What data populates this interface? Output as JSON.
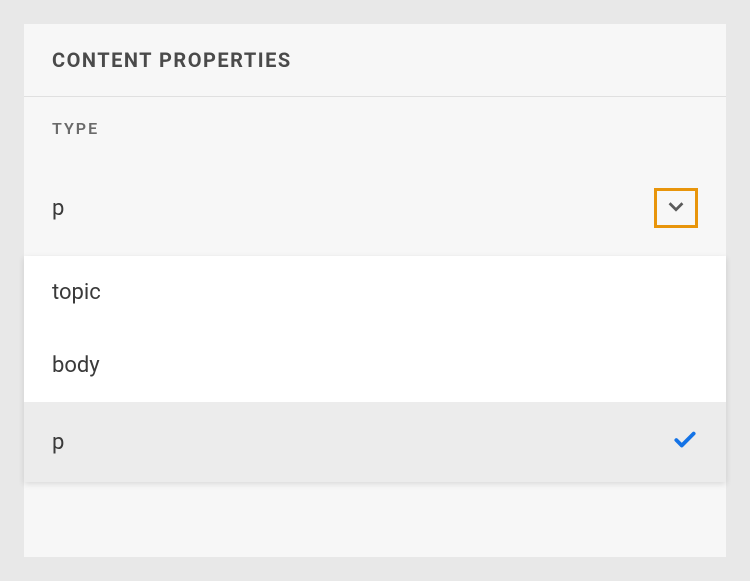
{
  "panel": {
    "title": "CONTENT PROPERTIES",
    "section_label": "TYPE",
    "selected_value": "p"
  },
  "dropdown": {
    "options": [
      {
        "label": "topic",
        "selected": false
      },
      {
        "label": "body",
        "selected": false
      },
      {
        "label": "p",
        "selected": true
      }
    ]
  }
}
